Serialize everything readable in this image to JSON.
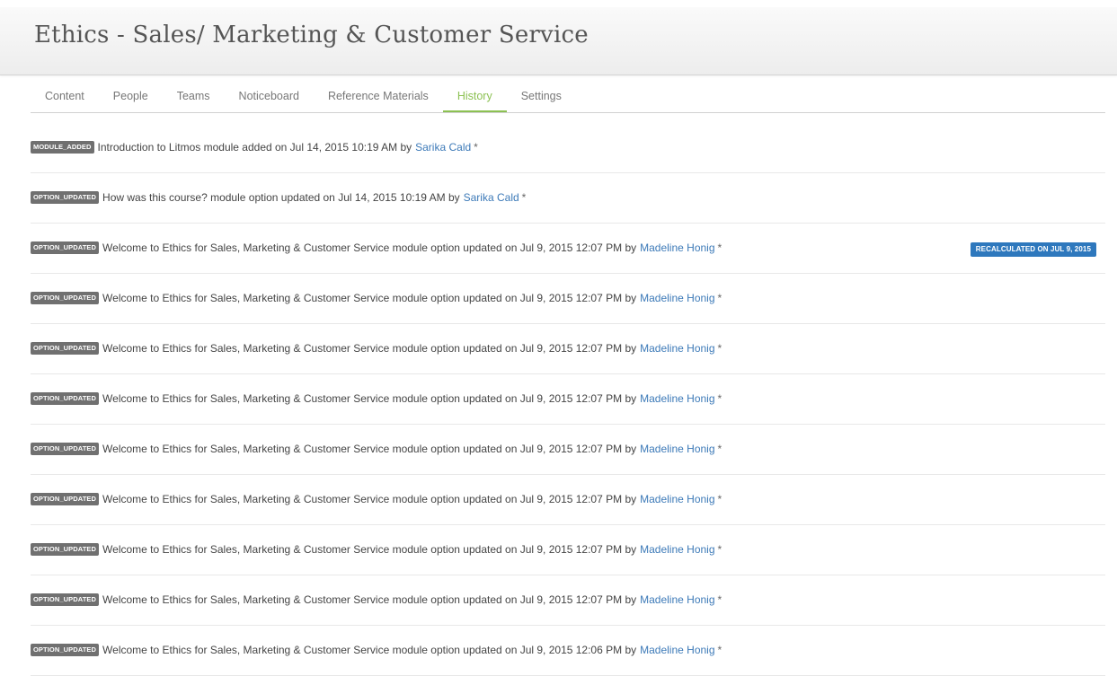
{
  "header": {
    "title": "Ethics - Sales/ Marketing & Customer Service"
  },
  "tabs": [
    {
      "label": "Content"
    },
    {
      "label": "People"
    },
    {
      "label": "Teams"
    },
    {
      "label": "Noticeboard"
    },
    {
      "label": "Reference Materials"
    },
    {
      "label": "History",
      "active": true
    },
    {
      "label": "Settings"
    }
  ],
  "colors": {
    "active_tab": "#8cc152",
    "link": "#3d7ab8",
    "badge_gray": "#707070",
    "recalc_blue": "#2e78bd"
  },
  "history": [
    {
      "badge": "MODULE_ADDED",
      "text": "Introduction to Litmos module added on Jul 14, 2015 10:19 AM by",
      "user": "Sarika Cald",
      "star": "*",
      "recalc": ""
    },
    {
      "badge": "OPTION_UPDATED",
      "text": "How was this course? module option updated on Jul 14, 2015 10:19 AM by",
      "user": "Sarika Cald",
      "star": "*",
      "recalc": ""
    },
    {
      "badge": "OPTION_UPDATED",
      "text": "Welcome to Ethics for Sales, Marketing & Customer Service module option updated on Jul 9, 2015 12:07 PM by",
      "user": "Madeline Honig",
      "star": "*",
      "recalc": "RECALCULATED ON JUL 9, 2015"
    },
    {
      "badge": "OPTION_UPDATED",
      "text": "Welcome to Ethics for Sales, Marketing & Customer Service module option updated on Jul 9, 2015 12:07 PM by",
      "user": "Madeline Honig",
      "star": "*",
      "recalc": ""
    },
    {
      "badge": "OPTION_UPDATED",
      "text": "Welcome to Ethics for Sales, Marketing & Customer Service module option updated on Jul 9, 2015 12:07 PM by",
      "user": "Madeline Honig",
      "star": "*",
      "recalc": ""
    },
    {
      "badge": "OPTION_UPDATED",
      "text": "Welcome to Ethics for Sales, Marketing & Customer Service module option updated on Jul 9, 2015 12:07 PM by",
      "user": "Madeline Honig",
      "star": "*",
      "recalc": ""
    },
    {
      "badge": "OPTION_UPDATED",
      "text": "Welcome to Ethics for Sales, Marketing & Customer Service module option updated on Jul 9, 2015 12:07 PM by",
      "user": "Madeline Honig",
      "star": "*",
      "recalc": ""
    },
    {
      "badge": "OPTION_UPDATED",
      "text": "Welcome to Ethics for Sales, Marketing & Customer Service module option updated on Jul 9, 2015 12:07 PM by",
      "user": "Madeline Honig",
      "star": "*",
      "recalc": ""
    },
    {
      "badge": "OPTION_UPDATED",
      "text": "Welcome to Ethics for Sales, Marketing & Customer Service module option updated on Jul 9, 2015 12:07 PM by",
      "user": "Madeline Honig",
      "star": "*",
      "recalc": ""
    },
    {
      "badge": "OPTION_UPDATED",
      "text": "Welcome to Ethics for Sales, Marketing & Customer Service module option updated on Jul 9, 2015 12:07 PM by",
      "user": "Madeline Honig",
      "star": "*",
      "recalc": ""
    },
    {
      "badge": "OPTION_UPDATED",
      "text": "Welcome to Ethics for Sales, Marketing & Customer Service module option updated on Jul 9, 2015 12:06 PM by",
      "user": "Madeline Honig",
      "star": "*",
      "recalc": ""
    }
  ]
}
